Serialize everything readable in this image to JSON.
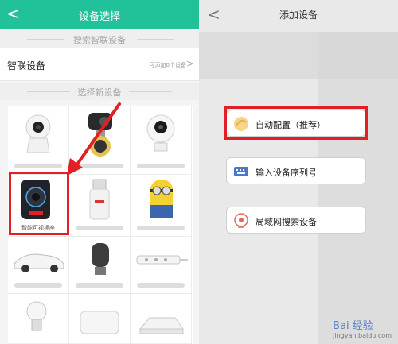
{
  "left_screen": {
    "header": {
      "title": "设备选择",
      "back": "<"
    },
    "search_section": {
      "title": "搜索智联设备"
    },
    "smart_row": {
      "label": "智联设备",
      "hint": "可添加0个设备",
      "chevron": ">"
    },
    "new_section": {
      "title": "选择新设备"
    },
    "devices": [
      {
        "label": "",
        "icon": "camera-round-icon"
      },
      {
        "label": "",
        "icon": "camera-bulb-icon"
      },
      {
        "label": "",
        "icon": "camera-ball-icon"
      },
      {
        "label": "智能可视插座",
        "icon": "smart-socket-icon"
      },
      {
        "label": "",
        "icon": "bulb-socket-icon"
      },
      {
        "label": "",
        "icon": "minion-toy-icon"
      },
      {
        "label": "",
        "icon": "car-icon"
      },
      {
        "label": "",
        "icon": "lamp-icon"
      },
      {
        "label": "",
        "icon": "power-strip-icon"
      },
      {
        "label": "",
        "icon": "bulb-icon"
      },
      {
        "label": "",
        "icon": "router-box-icon"
      },
      {
        "label": "",
        "icon": "router-flat-icon"
      }
    ]
  },
  "right_screen": {
    "header": {
      "title": "添加设备",
      "back": "<"
    },
    "options": [
      {
        "label": "自动配置（推荐）",
        "icon": "auto-config-icon"
      },
      {
        "label": "输入设备序列号",
        "icon": "keyboard-icon"
      },
      {
        "label": "局域网搜索设备",
        "icon": "lan-search-icon"
      }
    ]
  },
  "watermark": {
    "text": "Bai 经验",
    "sub": "jingyan.baidu.com"
  },
  "colors": {
    "header_green": "#21c29a",
    "highlight_red": "#e21e26"
  }
}
